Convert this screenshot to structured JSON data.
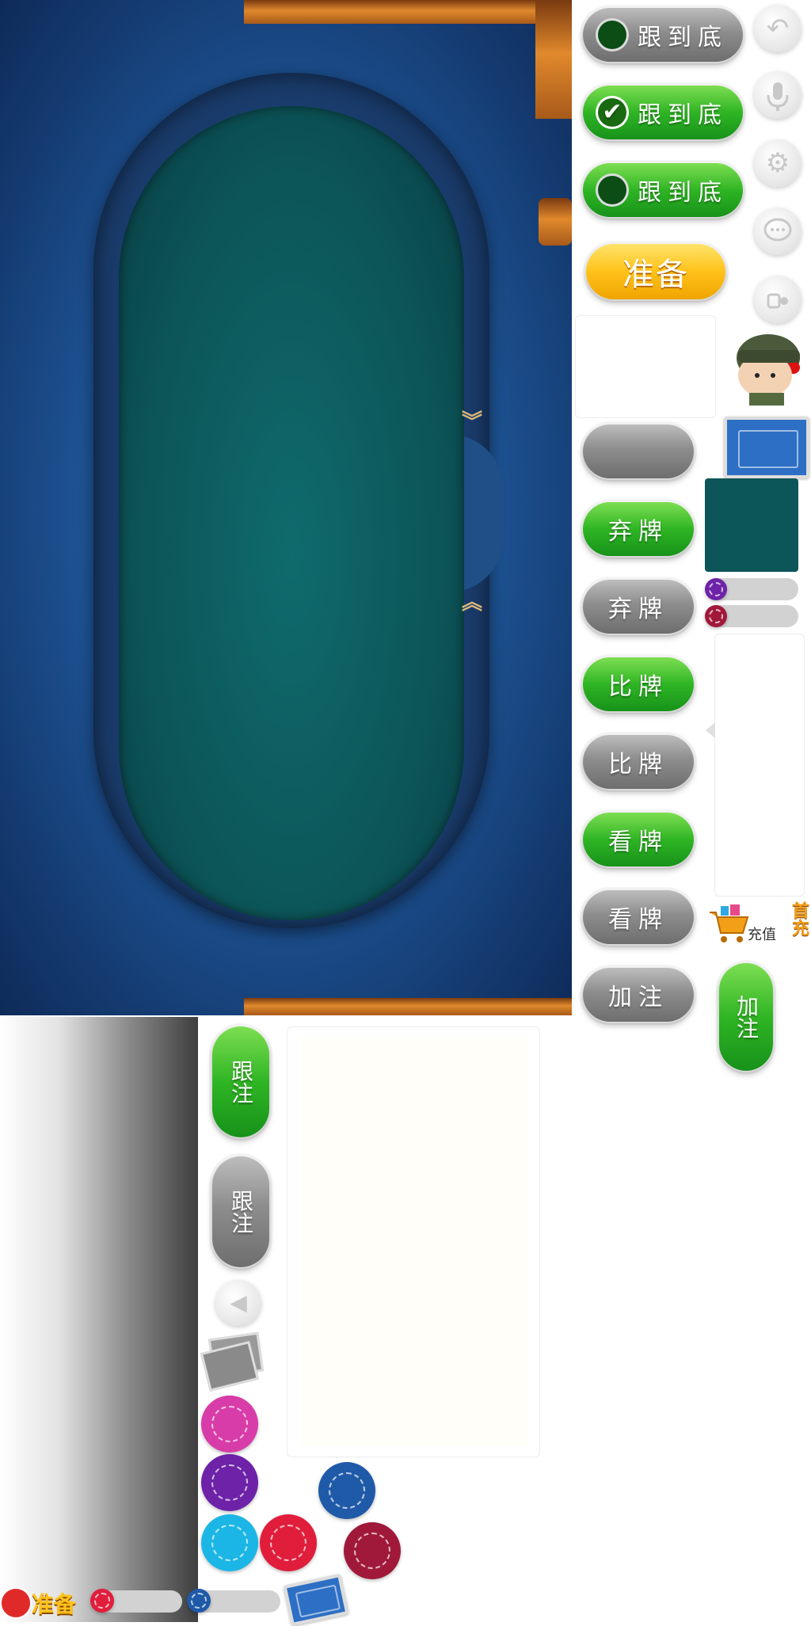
{
  "follow_to_end": {
    "off_label": "跟到底",
    "checked_label": "跟到底",
    "on_label": "跟到底",
    "check_mark": "✔"
  },
  "ready_button": {
    "label": "准备"
  },
  "actions": {
    "fold_green": "弃牌",
    "fold_grey": "弃牌",
    "compare_green": "比牌",
    "compare_grey": "比牌",
    "look_green": "看牌",
    "look_grey": "看牌",
    "raise_grey": "加注",
    "raise_green_vertical": "加注",
    "call_green_vertical": "跟注",
    "call_grey_vertical": "跟注"
  },
  "recharge": {
    "label": "充值",
    "badge": "首充"
  },
  "ready_badge": {
    "label": "准备"
  },
  "chip_colors": {
    "magenta": "#d83ca8",
    "purple": "#6d22a8",
    "blue": "#1f5aa8",
    "cyan": "#1bb6e6",
    "red": "#e01e3c",
    "maroon": "#a0193a"
  },
  "colors": {
    "felt": "#0c5558",
    "table_blue": "#1c4f8e",
    "button_green": "#2fb524",
    "button_grey": "#8d8d8d",
    "button_yellow": "#ffc21a"
  },
  "icons": [
    "back-icon",
    "microphone-icon",
    "gear-icon",
    "chat-icon",
    "profile-icon"
  ]
}
